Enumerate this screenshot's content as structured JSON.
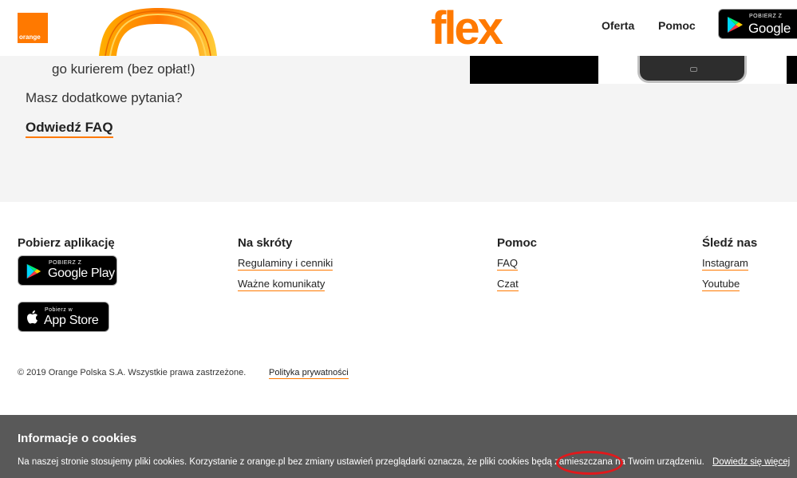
{
  "header": {
    "orange_logo_text": "orange",
    "brand": "flex",
    "nav": [
      "Oferta",
      "Pomoc"
    ],
    "google_play_small": "POBIERZ Z",
    "google_play_big": "Google Play"
  },
  "main": {
    "courier_text": "go kurierem (bez opłat!)",
    "question": "Masz dodatkowe pytania?",
    "faq_link": "Odwiedź FAQ"
  },
  "footer": {
    "app_column": {
      "title": "Pobierz aplikację",
      "google_play_small": "POBIERZ Z",
      "google_play_big": "Google Play",
      "app_store_small": "Pobierz w",
      "app_store_big": "App Store"
    },
    "shortcuts": {
      "title": "Na skróty",
      "links": [
        "Regulaminy i cenniki",
        "Ważne komunikaty"
      ]
    },
    "help": {
      "title": "Pomoc",
      "links": [
        "FAQ",
        "Czat"
      ]
    },
    "follow": {
      "title": "Śledź nas",
      "links": [
        "Instagram",
        "Youtube"
      ]
    },
    "copyright": "© 2019 Orange Polska S.A. Wszystkie prawa zastrzeżone.",
    "privacy": "Polityka prywatności"
  },
  "cookie": {
    "title": "Informacje o cookies",
    "text": "Na naszej stronie stosujemy pliki cookies. Korzystanie z orange.pl bez zmiany ustawień przeglądarki oznacza, że pliki cookies będą zamieszczana na Twoim urządzeniu.",
    "more": "Dowiedz się więcej"
  },
  "colors": {
    "brand_orange": "#ff7900",
    "cookie_bg": "#595959",
    "annotation_red": "#e0191c"
  }
}
